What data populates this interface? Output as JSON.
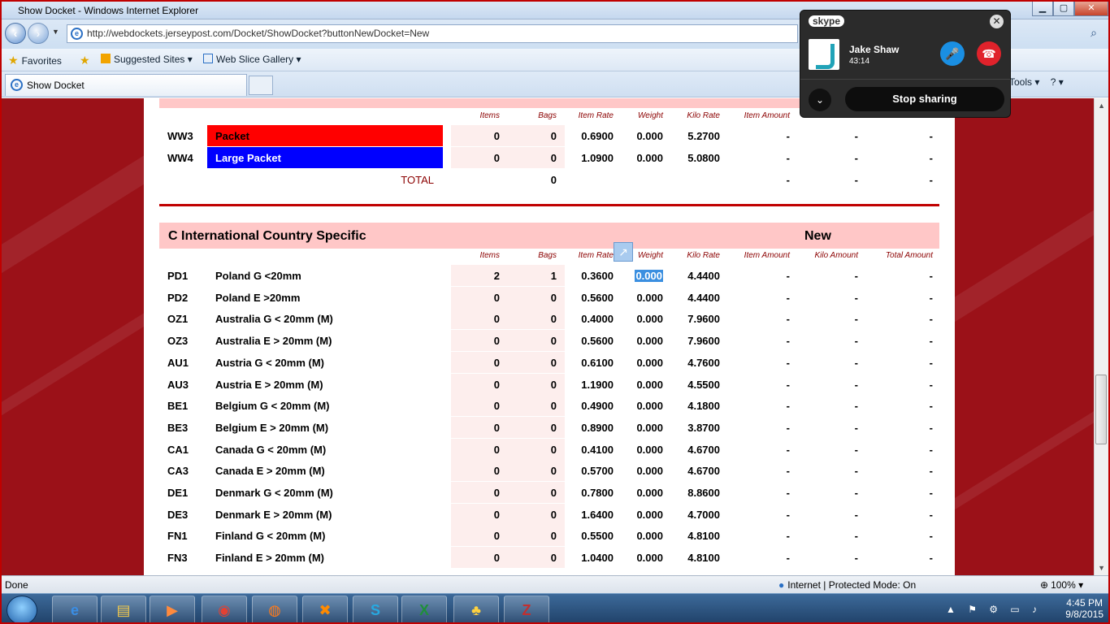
{
  "window": {
    "title": "Show Docket - Windows Internet Explorer",
    "minimize": "▁",
    "maximize": "▢",
    "close": "✕"
  },
  "address": {
    "url": "http://webdockets.jerseypost.com/Docket/ShowDocket?buttonNewDocket=New"
  },
  "favorites": {
    "favorites_label": "Favorites",
    "suggested": "Suggested Sites ▾",
    "webslice": "Web Slice Gallery ▾"
  },
  "tab": {
    "title": "Show Docket"
  },
  "toolbar": {
    "tools": "Tools ▾",
    "help": "? ▾"
  },
  "columns": {
    "items": "Items",
    "bags": "Bags",
    "item_rate": "Item Rate",
    "weight": "Weight",
    "kilo_rate": "Kilo Rate",
    "item_amount": "Item Amount",
    "kilo_amount": "Kilo Amount",
    "total_amount": "Total Amount"
  },
  "section_b": {
    "rows": [
      {
        "code": "WW3",
        "desc": "Packet",
        "items": "0",
        "bags": "0",
        "rate": "0.6900",
        "weight": "0.000",
        "kilo": "5.2700",
        "iamt": "-",
        "kamt": "-",
        "tamt": "-"
      },
      {
        "code": "WW4",
        "desc": "Large Packet",
        "items": "0",
        "bags": "0",
        "rate": "1.0900",
        "weight": "0.000",
        "kilo": "5.0800",
        "iamt": "-",
        "kamt": "-",
        "tamt": "-"
      }
    ],
    "total_label": "TOTAL",
    "total_bags": "0",
    "total_iamt": "-",
    "total_kamt": "-",
    "total_tamt": "-"
  },
  "section_c": {
    "title": "C International Country Specific",
    "status": "New",
    "rows": [
      {
        "code": "PD1",
        "desc": "Poland G <20mm",
        "items": "2",
        "bags": "1",
        "rate": "0.3600",
        "weight": "0.000",
        "kilo": "4.4400",
        "iamt": "-",
        "kamt": "-",
        "tamt": "-"
      },
      {
        "code": "PD2",
        "desc": "Poland E >20mm",
        "items": "0",
        "bags": "0",
        "rate": "0.5600",
        "weight": "0.000",
        "kilo": "4.4400",
        "iamt": "-",
        "kamt": "-",
        "tamt": "-"
      },
      {
        "code": "OZ1",
        "desc": "Australia G < 20mm (M)",
        "items": "0",
        "bags": "0",
        "rate": "0.4000",
        "weight": "0.000",
        "kilo": "7.9600",
        "iamt": "-",
        "kamt": "-",
        "tamt": "-"
      },
      {
        "code": "OZ3",
        "desc": "Australia E > 20mm (M)",
        "items": "0",
        "bags": "0",
        "rate": "0.5600",
        "weight": "0.000",
        "kilo": "7.9600",
        "iamt": "-",
        "kamt": "-",
        "tamt": "-"
      },
      {
        "code": "AU1",
        "desc": "Austria G < 20mm (M)",
        "items": "0",
        "bags": "0",
        "rate": "0.6100",
        "weight": "0.000",
        "kilo": "4.7600",
        "iamt": "-",
        "kamt": "-",
        "tamt": "-"
      },
      {
        "code": "AU3",
        "desc": "Austria E > 20mm (M)",
        "items": "0",
        "bags": "0",
        "rate": "1.1900",
        "weight": "0.000",
        "kilo": "4.5500",
        "iamt": "-",
        "kamt": "-",
        "tamt": "-"
      },
      {
        "code": "BE1",
        "desc": "Belgium G < 20mm (M)",
        "items": "0",
        "bags": "0",
        "rate": "0.4900",
        "weight": "0.000",
        "kilo": "4.1800",
        "iamt": "-",
        "kamt": "-",
        "tamt": "-"
      },
      {
        "code": "BE3",
        "desc": "Belgium E > 20mm (M)",
        "items": "0",
        "bags": "0",
        "rate": "0.8900",
        "weight": "0.000",
        "kilo": "3.8700",
        "iamt": "-",
        "kamt": "-",
        "tamt": "-"
      },
      {
        "code": "CA1",
        "desc": "Canada G < 20mm (M)",
        "items": "0",
        "bags": "0",
        "rate": "0.4100",
        "weight": "0.000",
        "kilo": "4.6700",
        "iamt": "-",
        "kamt": "-",
        "tamt": "-"
      },
      {
        "code": "CA3",
        "desc": "Canada E > 20mm (M)",
        "items": "0",
        "bags": "0",
        "rate": "0.5700",
        "weight": "0.000",
        "kilo": "4.6700",
        "iamt": "-",
        "kamt": "-",
        "tamt": "-"
      },
      {
        "code": "DE1",
        "desc": "Denmark G < 20mm (M)",
        "items": "0",
        "bags": "0",
        "rate": "0.7800",
        "weight": "0.000",
        "kilo": "8.8600",
        "iamt": "-",
        "kamt": "-",
        "tamt": "-"
      },
      {
        "code": "DE3",
        "desc": "Denmark E > 20mm (M)",
        "items": "0",
        "bags": "0",
        "rate": "1.6400",
        "weight": "0.000",
        "kilo": "4.7000",
        "iamt": "-",
        "kamt": "-",
        "tamt": "-"
      },
      {
        "code": "FN1",
        "desc": "Finland G < 20mm (M)",
        "items": "0",
        "bags": "0",
        "rate": "0.5500",
        "weight": "0.000",
        "kilo": "4.8100",
        "iamt": "-",
        "kamt": "-",
        "tamt": "-"
      },
      {
        "code": "FN3",
        "desc": "Finland E > 20mm (M)",
        "items": "0",
        "bags": "0",
        "rate": "1.0400",
        "weight": "0.000",
        "kilo": "4.8100",
        "iamt": "-",
        "kamt": "-",
        "tamt": "-"
      }
    ]
  },
  "skype": {
    "logo": "skype",
    "contact_name": "Jake Shaw",
    "call_time": "43:14",
    "stop_sharing": "Stop sharing"
  },
  "statusbar": {
    "status": "Done",
    "zone": "Internet | Protected Mode: On",
    "zoom": "100% ▾"
  },
  "taskbar": {
    "time": "4:45 PM",
    "date": "9/8/2015"
  },
  "colors": {
    "packet_bg": "#ff0000",
    "large_packet_bg": "#0000ff",
    "section_bg": "#ffc7c7",
    "accent": "#c00000"
  }
}
